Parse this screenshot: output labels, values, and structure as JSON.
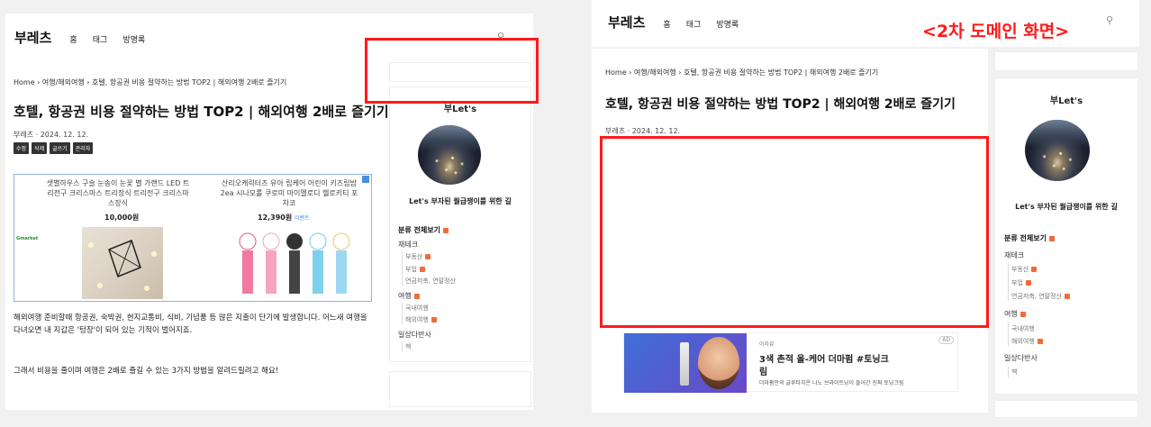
{
  "left": {
    "logo": "부레츠",
    "nav": [
      "홈",
      "태그",
      "방명록"
    ],
    "breadcrumb": "Home › 여행/해외여행 › 호텔, 항공권 비용 절약하는 방법 TOP2 | 해외여행 2배로 즐기기",
    "title": "호텔, 항공권 비용 절약하는 방법 TOP2 | 해외여행 2배로 즐기기",
    "meta": "부레츠 · 2024. 12. 12.",
    "buttons": [
      "수정",
      "삭제",
      "글쓰기",
      "관리자"
    ],
    "ad": {
      "product1": "샛별하우스 구슬 눈송이 눈꽃 별 가랜드 LED 트리전구 크리스마스 트리장식 트리전구 크리스마스장식",
      "price1": "10,000원",
      "product2": "산리오캐릭터즈 유아 립케어 어린이 키즈립밤 2ea 시나모롤 쿠로미 마이멜로디 헬로키티 포차코",
      "price2": "12,390원",
      "vendor": "Gmarket",
      "price2_tag": "이벤트"
    },
    "body": [
      "해외여행 준비할때 항공권, 숙박권, 현지교통비, 식비, 기념품 등 많은 지출이 단기에 발생합니다. 어느새 여행을 다녀오면 내 지갑은 '텅장'이 되어 있는 기적이 벌어지죠.",
      "그래서 비용을 줄이며 여행은 2배로 즐길 수 있는 3가지 방법을 알려드릴려고 해요!"
    ],
    "sidebar": {
      "name": "부Let's",
      "tagline": "Let's 부자된 월급쟁이를 위한 길",
      "all": "분류 전체보기",
      "cat1": "재테크",
      "cat1_items": [
        "부동산",
        "부업",
        "연금저축, 연말정산"
      ],
      "cat2": "여행",
      "cat2_items": [
        "국내여행",
        "해외여행"
      ],
      "cat3": "일상다반사",
      "cat3_items": [
        "책"
      ]
    }
  },
  "right": {
    "domain_label": "<2차 도메인 화면>",
    "logo": "부레츠",
    "nav": [
      "홈",
      "태그",
      "방명록"
    ],
    "breadcrumb": "Home › 여행/해외여행 › 호텔, 항공권 비용 절약하는 방법 TOP2 | 해외여행 2배로 즐기기",
    "title": "호텔, 항공권 비용 절약하는 방법 TOP2 | 해외여행 2배로 즐기기",
    "meta": "부레츠 · 2024. 12. 12.",
    "ad": {
      "brand": "아자뷰",
      "headline1": "3색 촌적 올-케어 더마펌 #토닝크",
      "headline2": "림",
      "desc": "더마펌만의 글루타치온 나노 브라이트닝이 들어간 진짜 토닝크림",
      "badge": "AD"
    },
    "sidebar": {
      "name": "부Let's",
      "tagline": "Let's 부자된 월급쟁이를 위한 길",
      "all": "분류 전체보기",
      "cat1": "재테크",
      "cat1_items": [
        "부동산",
        "부업",
        "연금저축, 연말정산"
      ],
      "cat2": "여행",
      "cat2_items": [
        "국내여행",
        "해외여행"
      ],
      "cat3": "일상다반사",
      "cat3_items": [
        "책"
      ]
    }
  },
  "colors": {
    "highlight": "#ff1a1a",
    "accent_badge": "#f26b3a"
  },
  "icons": [
    "search-icon",
    "new-badge-icon",
    "ad-choices-icon"
  ]
}
